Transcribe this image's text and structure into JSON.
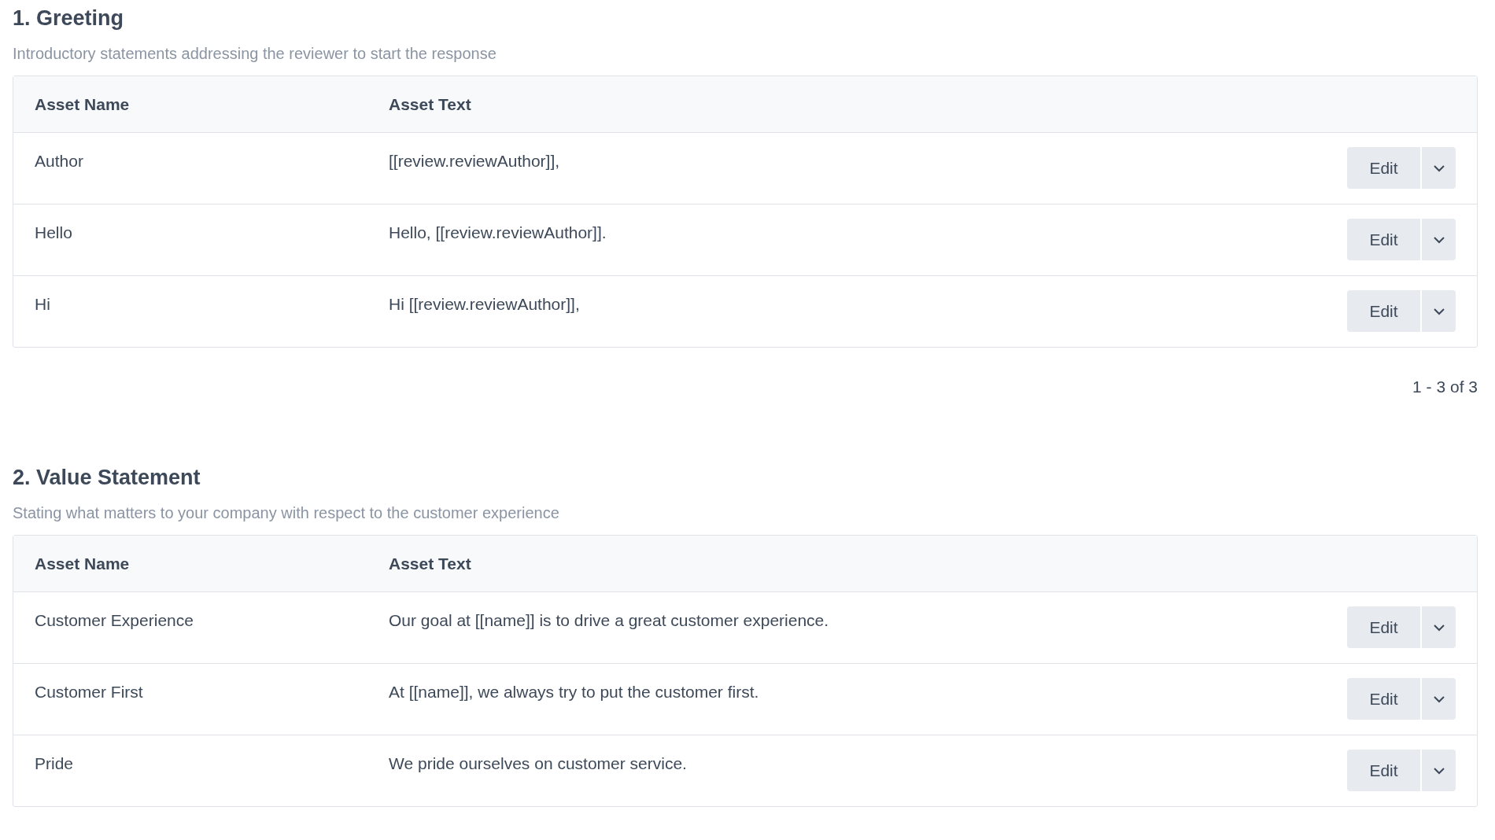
{
  "sections": [
    {
      "title": "1. Greeting",
      "description": "Introductory statements addressing the reviewer to start the response",
      "columns": [
        "Asset Name",
        "Asset Text"
      ],
      "rows": [
        {
          "name": "Author",
          "text": "[[review.reviewAuthor]],",
          "action": "Edit"
        },
        {
          "name": "Hello",
          "text": "Hello, [[review.reviewAuthor]].",
          "action": "Edit"
        },
        {
          "name": "Hi",
          "text": "Hi [[review.reviewAuthor]],",
          "action": "Edit"
        }
      ],
      "pagination": "1 - 3 of 3"
    },
    {
      "title": "2. Value Statement",
      "description": "Stating what matters to your company with respect to the customer experience",
      "columns": [
        "Asset Name",
        "Asset Text"
      ],
      "rows": [
        {
          "name": "Customer Experience",
          "text": "Our goal at [[name]] is to drive a great customer experience.",
          "action": "Edit"
        },
        {
          "name": "Customer First",
          "text": "At [[name]], we always try to put the customer first.",
          "action": "Edit"
        },
        {
          "name": "Pride",
          "text": "We pride ourselves on customer service.",
          "action": "Edit"
        }
      ]
    }
  ]
}
